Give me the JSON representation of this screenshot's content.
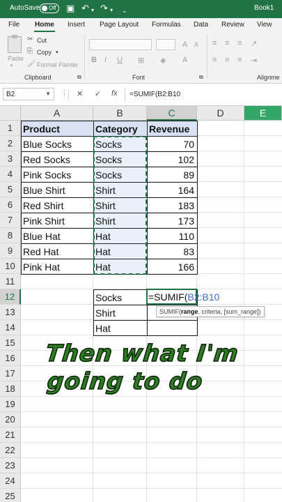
{
  "titlebar": {
    "autosave_label": "AutoSave",
    "autosave_state": "Off",
    "book_name": "Book1",
    "save_icon": "save-icon",
    "undo_icon": "undo-icon",
    "redo_icon": "redo-icon",
    "more_icon": "chevron-down-icon"
  },
  "ribbon": {
    "tabs": [
      "File",
      "Home",
      "Insert",
      "Page Layout",
      "Formulas",
      "Data",
      "Review",
      "View"
    ],
    "active_tab": "Home",
    "paste": "Paste",
    "cut": "Cut",
    "copy": "Copy",
    "format_painter": "Format Painter",
    "clipboard_group": "Clipboard",
    "font_group": "Font",
    "alignment_group": "Alignme",
    "bold": "B",
    "italic": "I",
    "underline": "U"
  },
  "formula_bar": {
    "name_box": "B2",
    "cancel": "✕",
    "enter": "✓",
    "fx": "fx",
    "formula": "=SUMIF(B2:B10"
  },
  "grid": {
    "columns": [
      "A",
      "B",
      "C",
      "D",
      "E"
    ],
    "rows": [
      "1",
      "2",
      "3",
      "4",
      "5",
      "6",
      "7",
      "8",
      "9",
      "10",
      "11",
      "12",
      "13",
      "14",
      "15",
      "16",
      "17",
      "18",
      "19",
      "20",
      "21",
      "22",
      "23",
      "24",
      "25"
    ],
    "headers": {
      "product": "Product",
      "category": "Category",
      "revenue": "Revenue"
    },
    "data": [
      {
        "product": "Blue Socks",
        "category": "Socks",
        "revenue": "70"
      },
      {
        "product": "Red Socks",
        "category": "Socks",
        "revenue": "102"
      },
      {
        "product": "Pink Socks",
        "category": "Socks",
        "revenue": "89"
      },
      {
        "product": "Blue Shirt",
        "category": "Shirt",
        "revenue": "164"
      },
      {
        "product": "Red Shirt",
        "category": "Shirt",
        "revenue": "183"
      },
      {
        "product": "Pink Shirt",
        "category": "Shirt",
        "revenue": "173"
      },
      {
        "product": "Blue Hat",
        "category": "Hat",
        "revenue": "110"
      },
      {
        "product": "Red Hat",
        "category": "Hat",
        "revenue": "83"
      },
      {
        "product": "Pink Hat",
        "category": "Hat",
        "revenue": "166"
      }
    ],
    "summary": [
      "Socks",
      "Shirt",
      "Hat"
    ],
    "active_input": {
      "prefix": "=SUMIF(",
      "ref": "B2:B10"
    },
    "tooltip": {
      "fn": "SUMIF(",
      "arg1": "range",
      "rest": ", criteria, [sum_range])"
    }
  },
  "overlay": {
    "line1": "Then what I'm",
    "line2": "going to do"
  },
  "colors": {
    "excel_green": "#217346",
    "header_fill": "#d9e1f2",
    "overlay_text": "#2f7d23"
  }
}
